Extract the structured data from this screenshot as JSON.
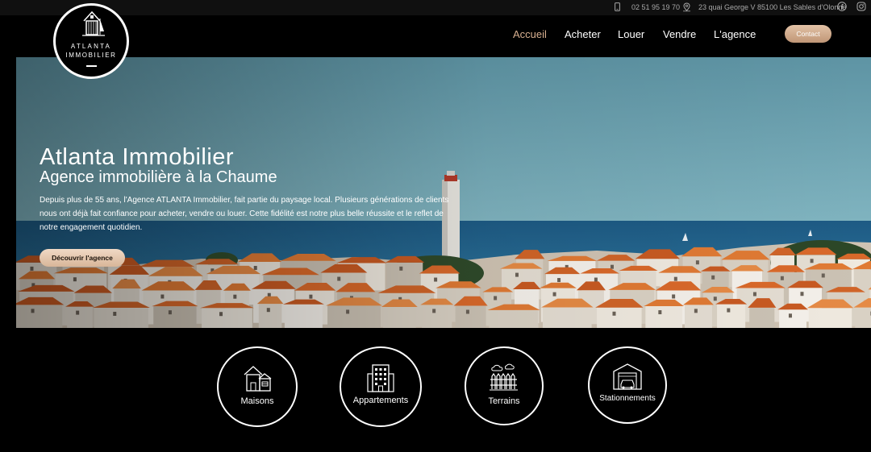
{
  "topbar": {
    "phone": "02 51 95 19 70",
    "address": "23 quai George V 85100 Les Sables d'Olonne",
    "phone_icon": "phone-icon",
    "location_icon": "location-icon",
    "facebook_icon": "facebook-icon",
    "instagram_icon": "instagram-icon"
  },
  "logo": {
    "line1": "ATLANTA",
    "line2": "IMMOBILIER"
  },
  "nav": {
    "items": [
      "Accueil",
      "Acheter",
      "Louer",
      "Vendre",
      "L'agence"
    ],
    "active": "Accueil",
    "contact_label": "Contact"
  },
  "hero": {
    "title": "Atlanta Immobilier",
    "subtitle": "Agence immobilière à la Chaume",
    "description": "Depuis plus de 55 ans,  l'Agence ATLANTA Immobilier, fait partie du paysage local. Plusieurs générations de clients nous ont déjà fait confiance pour acheter, vendre ou louer. Cette fidélité est notre plus belle réussite et le reflet de notre engagement quotidien.",
    "cta_label": "Découvrir l'agence"
  },
  "categories": [
    {
      "label": "Maisons",
      "icon": "house-icon"
    },
    {
      "label": "Appartements",
      "icon": "apartment-building-icon"
    },
    {
      "label": "Terrains",
      "icon": "land-fence-icon"
    },
    {
      "label": "Stationnements",
      "icon": "garage-icon"
    }
  ],
  "colors": {
    "accent": "#d8b090",
    "button": "#c8a080",
    "background": "#000000",
    "sea": "#1f5f8a",
    "sky": "#6fa5b3",
    "roofs": "#d86a2a"
  }
}
